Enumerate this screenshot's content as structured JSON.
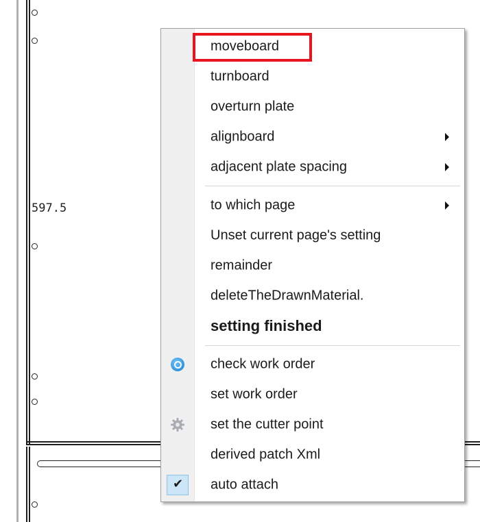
{
  "canvas": {
    "coordinate_label": "597.5"
  },
  "context_menu": {
    "items": [
      {
        "label": "moveboard",
        "highlighted": true
      },
      {
        "label": "turnboard"
      },
      {
        "label": "overturn plate"
      },
      {
        "label": "alignboard",
        "has_submenu": true
      },
      {
        "label": "adjacent plate spacing",
        "has_submenu": true
      },
      {
        "label": "to which page",
        "has_submenu": true
      },
      {
        "label": "Unset current page's setting"
      },
      {
        "label": "remainder"
      },
      {
        "label": "deleteTheDrawnMaterial."
      },
      {
        "label": "setting finished",
        "bold": true
      },
      {
        "label": "check work order",
        "icon": "search-icon"
      },
      {
        "label": "set work order"
      },
      {
        "label": "set the cutter point",
        "icon": "gear-icon"
      },
      {
        "label": "derived patch Xml"
      },
      {
        "label": "auto attach",
        "icon": "checkmark-icon",
        "checked": true
      }
    ],
    "highlight_color": "#e8161c"
  }
}
